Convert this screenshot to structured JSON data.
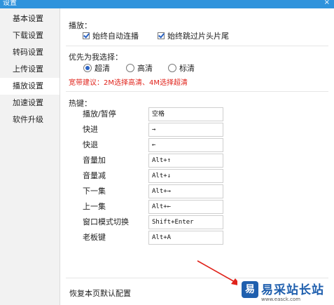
{
  "window": {
    "title": "设置",
    "close_label": "×"
  },
  "sidebar": {
    "items": [
      {
        "label": "基本设置"
      },
      {
        "label": "下载设置"
      },
      {
        "label": "转码设置"
      },
      {
        "label": "上传设置"
      },
      {
        "label": "播放设置",
        "active": true
      },
      {
        "label": "加速设置"
      },
      {
        "label": "软件升级"
      }
    ]
  },
  "playback": {
    "section_title": "播放：",
    "autoplay_label": "始终自动连播",
    "autoplay_checked": true,
    "skip_label": "始终跳过片头片尾",
    "skip_checked": true
  },
  "quality": {
    "section_title": "优先为我选择：",
    "options": [
      {
        "label": "超清",
        "selected": true
      },
      {
        "label": "高清",
        "selected": false
      },
      {
        "label": "标清",
        "selected": false
      }
    ],
    "tip": "宽带建议：2M选择高清、4M选择超清"
  },
  "hotkeys": {
    "section_title": "热键：",
    "items": [
      {
        "label": "播放/暂停",
        "value": "空格"
      },
      {
        "label": "快进",
        "value": "→"
      },
      {
        "label": "快退",
        "value": "←"
      },
      {
        "label": "音量加",
        "value": "Alt+↑"
      },
      {
        "label": "音量减",
        "value": "Alt+↓"
      },
      {
        "label": "下一集",
        "value": "Alt+→"
      },
      {
        "label": "上一集",
        "value": "Alt+←"
      },
      {
        "label": "窗口模式切换",
        "value": "Shift+Enter"
      },
      {
        "label": "老板键",
        "value": "Alt+A"
      }
    ]
  },
  "footer": {
    "restore_label": "恢复本页默认配置"
  },
  "watermark": {
    "brand": "易采站长站",
    "url": "www.easck.com",
    "logo_glyph": "易"
  },
  "colors": {
    "titlebar": "#2f93dc",
    "tip": "#e0231b",
    "arrow": "#e0231b",
    "brand": "#1f5fae"
  }
}
